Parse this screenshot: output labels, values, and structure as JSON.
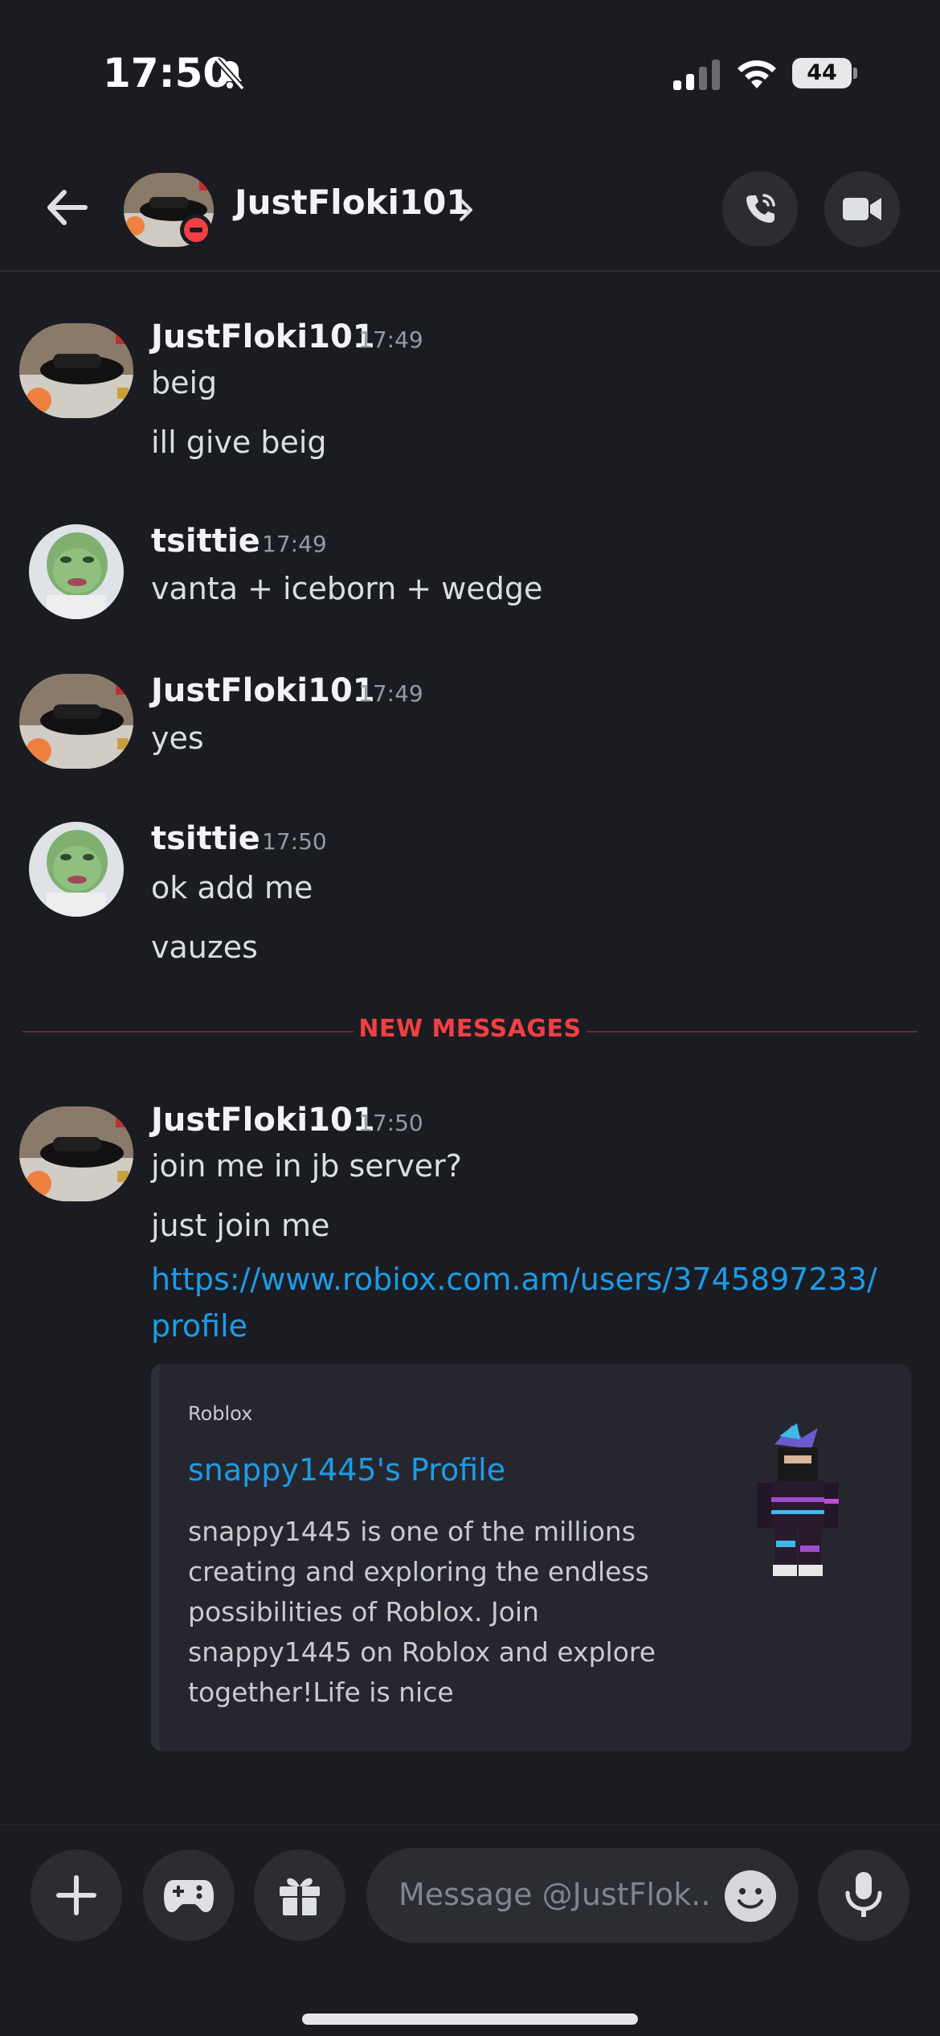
{
  "status_bar": {
    "time": "17:50",
    "battery": "44"
  },
  "header": {
    "title": "JustFloki101"
  },
  "messages": [
    {
      "author": "JustFloki101",
      "time": "17:49",
      "lines": [
        "beig",
        "ill give beig"
      ]
    },
    {
      "author": "tsittie",
      "time": "17:49",
      "lines": [
        "vanta + iceborn + wedge"
      ]
    },
    {
      "author": "JustFloki101",
      "time": "17:49",
      "lines": [
        "yes"
      ]
    },
    {
      "author": "tsittie",
      "time": "17:50",
      "lines": [
        "ok add me",
        "vauzes"
      ]
    },
    {
      "author": "JustFloki101",
      "time": "17:50",
      "lines": [
        "join me in jb server?",
        "just join me"
      ],
      "link_line1": "https://www.robiox.com.am/users/3745897233/",
      "link_line2": "profile"
    }
  ],
  "divider_label": "NEW MESSAGES",
  "embed": {
    "provider": "Roblox",
    "title": "snappy1445's Profile",
    "description": "snappy1445 is one of the millions creating and exploring the endless possibilities of Roblox. Join snappy1445 on Roblox and explore together!Life is nice"
  },
  "composer": {
    "placeholder": "Message @JustFlok.."
  },
  "colors": {
    "background": "#1b1c22",
    "link": "#1e9be6",
    "new_messages": "#f23f43",
    "dnd": "#f23f43"
  }
}
